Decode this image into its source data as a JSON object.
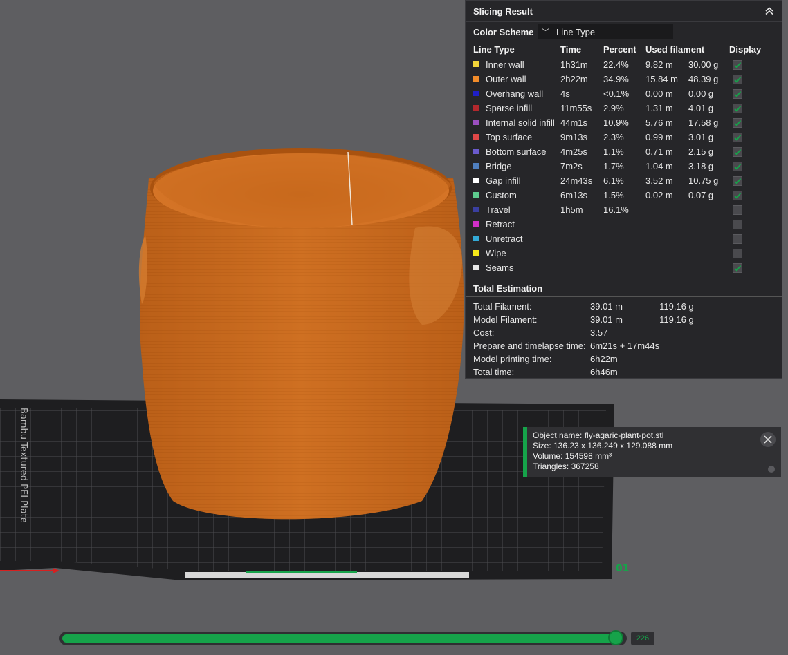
{
  "plate": {
    "side_label": "Bambu Textured PEI Plate",
    "plate_number": "01"
  },
  "panel": {
    "title": "Slicing Result",
    "color_scheme_label": "Color Scheme",
    "color_scheme_value": "Line Type",
    "columns": [
      "Line Type",
      "Time",
      "Percent",
      "Used filament",
      "Display"
    ],
    "rows": [
      {
        "name": "Inner wall",
        "color": "#f2d43a",
        "time": "1h31m",
        "percent": "22.4%",
        "meters": "9.82 m",
        "grams": "30.00 g",
        "display": true
      },
      {
        "name": "Outer wall",
        "color": "#f28c2a",
        "time": "2h22m",
        "percent": "34.9%",
        "meters": "15.84 m",
        "grams": "48.39 g",
        "display": true
      },
      {
        "name": "Overhang wall",
        "color": "#1f1fc8",
        "time": "4s",
        "percent": "<0.1%",
        "meters": "0.00 m",
        "grams": "0.00 g",
        "display": true
      },
      {
        "name": "Sparse infill",
        "color": "#b3282d",
        "time": "11m55s",
        "percent": "2.9%",
        "meters": "1.31 m",
        "grams": "4.01 g",
        "display": true
      },
      {
        "name": "Internal solid infill",
        "color": "#9b4fc0",
        "time": "44m1s",
        "percent": "10.9%",
        "meters": "5.76 m",
        "grams": "17.58 g",
        "display": true
      },
      {
        "name": "Top surface",
        "color": "#e04848",
        "time": "9m13s",
        "percent": "2.3%",
        "meters": "0.99 m",
        "grams": "3.01 g",
        "display": true
      },
      {
        "name": "Bottom surface",
        "color": "#6a5acd",
        "time": "4m25s",
        "percent": "1.1%",
        "meters": "0.71 m",
        "grams": "2.15 g",
        "display": true
      },
      {
        "name": "Bridge",
        "color": "#4f7fbf",
        "time": "7m2s",
        "percent": "1.7%",
        "meters": "1.04 m",
        "grams": "3.18 g",
        "display": true
      },
      {
        "name": "Gap infill",
        "color": "#ffffff",
        "time": "24m43s",
        "percent": "6.1%",
        "meters": "3.52 m",
        "grams": "10.75 g",
        "display": true
      },
      {
        "name": "Custom",
        "color": "#5ecb8e",
        "time": "6m13s",
        "percent": "1.5%",
        "meters": "0.02 m",
        "grams": "0.07 g",
        "display": true
      },
      {
        "name": "Travel",
        "color": "#3a3fa0",
        "time": "1h5m",
        "percent": "16.1%",
        "meters": "",
        "grams": "",
        "display": false
      },
      {
        "name": "Retract",
        "color": "#d12fc9",
        "time": "",
        "percent": "",
        "meters": "",
        "grams": "",
        "display": false
      },
      {
        "name": "Unretract",
        "color": "#33a9d6",
        "time": "",
        "percent": "",
        "meters": "",
        "grams": "",
        "display": false
      },
      {
        "name": "Wipe",
        "color": "#f5e81a",
        "time": "",
        "percent": "",
        "meters": "",
        "grams": "",
        "display": false
      },
      {
        "name": "Seams",
        "color": "#e6e6e6",
        "time": "",
        "percent": "",
        "meters": "",
        "grams": "",
        "display": true
      }
    ],
    "estimation_title": "Total Estimation",
    "estimation": [
      {
        "label": "Total Filament:",
        "v1": "39.01 m",
        "v2": "119.16 g"
      },
      {
        "label": "Model Filament:",
        "v1": "39.01 m",
        "v2": "119.16 g"
      },
      {
        "label": "Cost:",
        "v1": "3.57",
        "v2": ""
      },
      {
        "label": "Prepare and timelapse time:",
        "v1": "6m21s + 17m44s",
        "v2": ""
      },
      {
        "label": "Model printing time:",
        "v1": "6h22m",
        "v2": ""
      },
      {
        "label": "Total time:",
        "v1": "6h46m",
        "v2": ""
      }
    ]
  },
  "object_info": {
    "name": "Object name: fly-agaric-plant-pot.stl",
    "size": "Size: 136.23 x 136.249 x 129.088 mm",
    "volume": "Volume: 154598 mm³",
    "triangles": "Triangles: 367258"
  },
  "layer_slider": {
    "value": "226",
    "fraction": 0.985
  },
  "colors": {
    "accent": "#16a34a",
    "model": "#c8691e",
    "background": "#5e5e61"
  }
}
